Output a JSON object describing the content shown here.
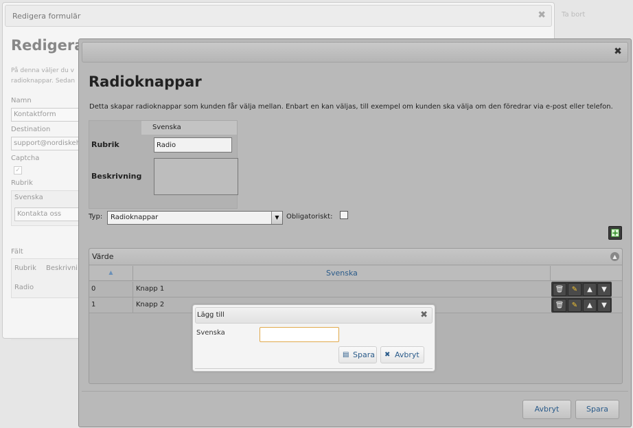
{
  "background": {
    "title": "Redigera formulär",
    "heading": "Redigera",
    "intro_line1": "På denna väljer du v",
    "intro_line2": "radioknappar. Sedan",
    "labels": {
      "namn": "Namn",
      "destination": "Destination",
      "captcha": "Captcha",
      "rubrik": "Rubrik",
      "falt": "Fält"
    },
    "namn_value": "Kontaktform",
    "destination_value": "support@nordiskeh",
    "rubrik_lang": "Svenska",
    "rubrik_value": "Kontakta oss",
    "fields_col1": "Rubrik",
    "fields_col2": "Beskrivni",
    "fields_row1": "Radio",
    "side_text": "Ta bort"
  },
  "dialog": {
    "heading": "Radioknappar",
    "description": "Detta skapar radioknappar som kunden får välja mellan. Enbart en kan väljas, till exempel om kunden ska välja om den föredrar via e-post eller telefon.",
    "lang_header": "Svenska",
    "rubrik_label": "Rubrik",
    "rubrik_value": "Radio",
    "beskrivning_label": "Beskrivning",
    "typ_label": "Typ:",
    "typ_value": "Radioknappar",
    "obligatoriskt_label": "Obligatoriskt:",
    "grid": {
      "caption": "Värde",
      "column_header": "Svenska",
      "rows": [
        {
          "id": "0",
          "value": "Knapp 1"
        },
        {
          "id": "1",
          "value": "Knapp 2"
        }
      ]
    },
    "footer": {
      "cancel_label": "Avbryt",
      "save_label": "Spara"
    }
  },
  "add_popup": {
    "title": "Lägg till",
    "lang_label": "Svenska",
    "input_value": "",
    "save_label": "Spara",
    "cancel_label": "Avbryt"
  },
  "colors": {
    "link_blue": "#2a5b8a",
    "focus_orange": "#e0a84a",
    "add_green": "#2a8a1e"
  },
  "icons": {
    "close": "close-icon",
    "add": "plus-icon",
    "delete": "trash-icon",
    "edit": "pencil-icon",
    "move_up": "arrow-up-icon",
    "move_down": "arrow-down-icon",
    "sort": "sort-icon",
    "collapse": "collapse-icon",
    "save": "save-icon"
  }
}
